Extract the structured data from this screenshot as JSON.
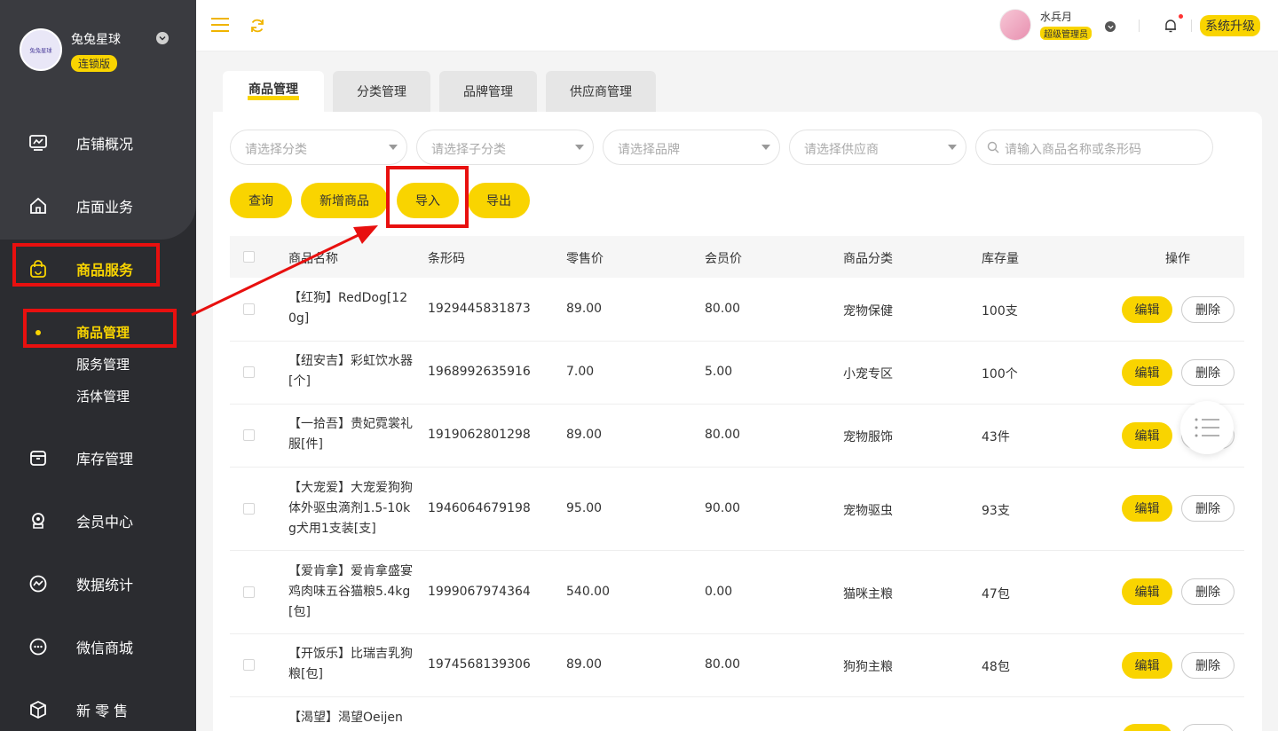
{
  "brand": {
    "name": "兔兔星球",
    "edition": "连锁版",
    "logo_text": "兔兔星球"
  },
  "nav": {
    "items": [
      {
        "label": "店铺概况",
        "icon": "monitor-icon"
      },
      {
        "label": "店面业务",
        "icon": "home-icon"
      },
      {
        "label": "商品服务",
        "icon": "bag-icon"
      },
      {
        "label": "库存管理",
        "icon": "box-icon"
      },
      {
        "label": "会员中心",
        "icon": "member-icon"
      },
      {
        "label": "数据统计",
        "icon": "chart-icon"
      },
      {
        "label": "微信商城",
        "icon": "chat-icon"
      },
      {
        "label": "新 零 售",
        "icon": "cube-icon"
      }
    ],
    "sub_items": [
      "商品管理",
      "服务管理",
      "活体管理"
    ]
  },
  "header": {
    "user_name": "水兵月",
    "user_role": "超级管理员",
    "upgrade_label": "系统升级"
  },
  "tabs": [
    "商品管理",
    "分类管理",
    "品牌管理",
    "供应商管理"
  ],
  "filters": {
    "category": "请选择分类",
    "sub_category": "请选择子分类",
    "brand": "请选择品牌",
    "supplier": "请选择供应商",
    "search": "请输入商品名称或条形码"
  },
  "actions": {
    "query": "查询",
    "add": "新增商品",
    "import": "导入",
    "export": "导出"
  },
  "table": {
    "headers": [
      "商品名称",
      "条形码",
      "零售价",
      "会员价",
      "商品分类",
      "库存量",
      "操作"
    ],
    "edit_label": "编辑",
    "delete_label": "删除",
    "rows": [
      {
        "name": "【红狗】RedDog[120g]",
        "barcode": "1929445831873",
        "retail": "89.00",
        "member": "80.00",
        "category": "宠物保健",
        "stock": "100支"
      },
      {
        "name": "【纽安吉】彩虹饮水器[个]",
        "barcode": "1968992635916",
        "retail": "7.00",
        "member": "5.00",
        "category": "小宠专区",
        "stock": "100个"
      },
      {
        "name": "【一拾吾】贵妃霓裳礼服[件]",
        "barcode": "1919062801298",
        "retail": "89.00",
        "member": "80.00",
        "category": "宠物服饰",
        "stock": "43件"
      },
      {
        "name": "【大宠爱】大宠爱狗狗体外驱虫滴剂1.5-10kg犬用1支装[支]",
        "barcode": "1946064679198",
        "retail": "95.00",
        "member": "90.00",
        "category": "宠物驱虫",
        "stock": "93支"
      },
      {
        "name": "【爱肯拿】爱肯拿盛宴鸡肉味五谷猫粮5.4kg[包]",
        "barcode": "1999067974364",
        "retail": "540.00",
        "member": "0.00",
        "category": "猫咪主粮",
        "stock": "47包"
      },
      {
        "name": "【开饭乐】比瑞吉乳狗粮[包]",
        "barcode": "1974568139306",
        "retail": "89.00",
        "member": "80.00",
        "category": "狗狗主粮",
        "stock": "48包"
      },
      {
        "name": "【渴望】渴望Oeijen",
        "barcode": "",
        "retail": "",
        "member": "",
        "category": "",
        "stock": ""
      }
    ]
  },
  "colors": {
    "accent": "#f9d400",
    "sidebar": "#2b2c30",
    "annotation": "#e8100f"
  }
}
